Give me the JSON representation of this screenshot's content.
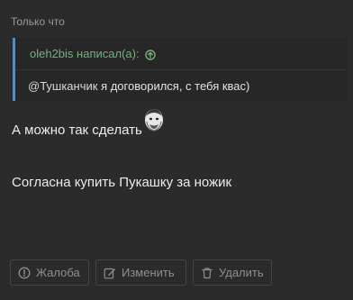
{
  "post": {
    "timestamp": "Только что",
    "quote": {
      "author": "oleh2bis написал(а):",
      "mention": "@Тушканчик",
      "text": " я договорился, с тебя квас)"
    },
    "lines": [
      "А можно так сделать",
      "Согласна купить Пукашку за ножик"
    ],
    "actions": {
      "report": "Жалоба",
      "edit": "Изменить",
      "delete": "Удалить"
    }
  },
  "icons": {
    "author_link": "arrow-up-circle-icon",
    "report": "exclamation-circle-icon",
    "edit": "edit-icon",
    "delete": "trash-icon",
    "emoji": "face-emoji-icon"
  },
  "colors": {
    "background": "#2b2b2b",
    "quote_bar": "#5d89b4",
    "quote_author": "#76b07a",
    "text": "#ececec",
    "muted": "#9a9a9a"
  }
}
